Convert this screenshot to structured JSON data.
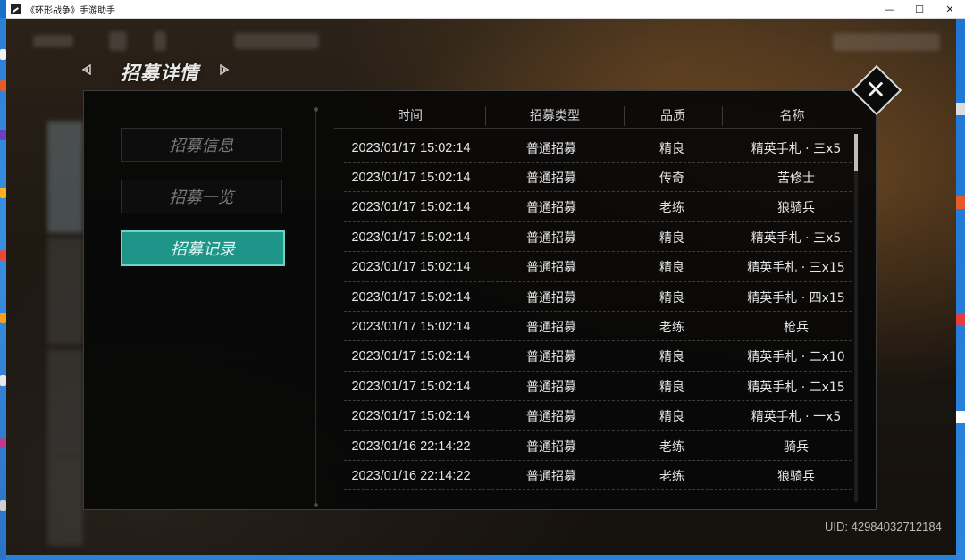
{
  "window": {
    "title": "《环形战争》手游助手",
    "minimize": "—",
    "maximize": "☐",
    "close": "✕"
  },
  "header": {
    "title": "招募详情"
  },
  "tabs": [
    {
      "label": "招募信息",
      "active": false
    },
    {
      "label": "招募一览",
      "active": false
    },
    {
      "label": "招募记录",
      "active": true
    }
  ],
  "table": {
    "columns": [
      "时间",
      "招募类型",
      "品质",
      "名称"
    ],
    "rows": [
      {
        "time": "2023/01/17 15:02:14",
        "type": "普通招募",
        "quality": "精良",
        "name": "精英手札 · 三x5"
      },
      {
        "time": "2023/01/17 15:02:14",
        "type": "普通招募",
        "quality": "传奇",
        "name": "苦修士"
      },
      {
        "time": "2023/01/17 15:02:14",
        "type": "普通招募",
        "quality": "老练",
        "name": "狼骑兵"
      },
      {
        "time": "2023/01/17 15:02:14",
        "type": "普通招募",
        "quality": "精良",
        "name": "精英手札 · 三x5"
      },
      {
        "time": "2023/01/17 15:02:14",
        "type": "普通招募",
        "quality": "精良",
        "name": "精英手札 · 三x15"
      },
      {
        "time": "2023/01/17 15:02:14",
        "type": "普通招募",
        "quality": "精良",
        "name": "精英手札 · 四x15"
      },
      {
        "time": "2023/01/17 15:02:14",
        "type": "普通招募",
        "quality": "老练",
        "name": "枪兵"
      },
      {
        "time": "2023/01/17 15:02:14",
        "type": "普通招募",
        "quality": "精良",
        "name": "精英手札 · 二x10"
      },
      {
        "time": "2023/01/17 15:02:14",
        "type": "普通招募",
        "quality": "精良",
        "name": "精英手札 · 二x15"
      },
      {
        "time": "2023/01/17 15:02:14",
        "type": "普通招募",
        "quality": "精良",
        "name": "精英手札 · 一x5"
      },
      {
        "time": "2023/01/16 22:14:22",
        "type": "普通招募",
        "quality": "老练",
        "name": "骑兵"
      },
      {
        "time": "2023/01/16 22:14:22",
        "type": "普通招募",
        "quality": "老练",
        "name": "狼骑兵"
      }
    ]
  },
  "uid": "UID: 42984032712184",
  "colors": {
    "active_tab": "#1f958a",
    "panel_bg": "#080808",
    "text": "#e6e6e6"
  }
}
